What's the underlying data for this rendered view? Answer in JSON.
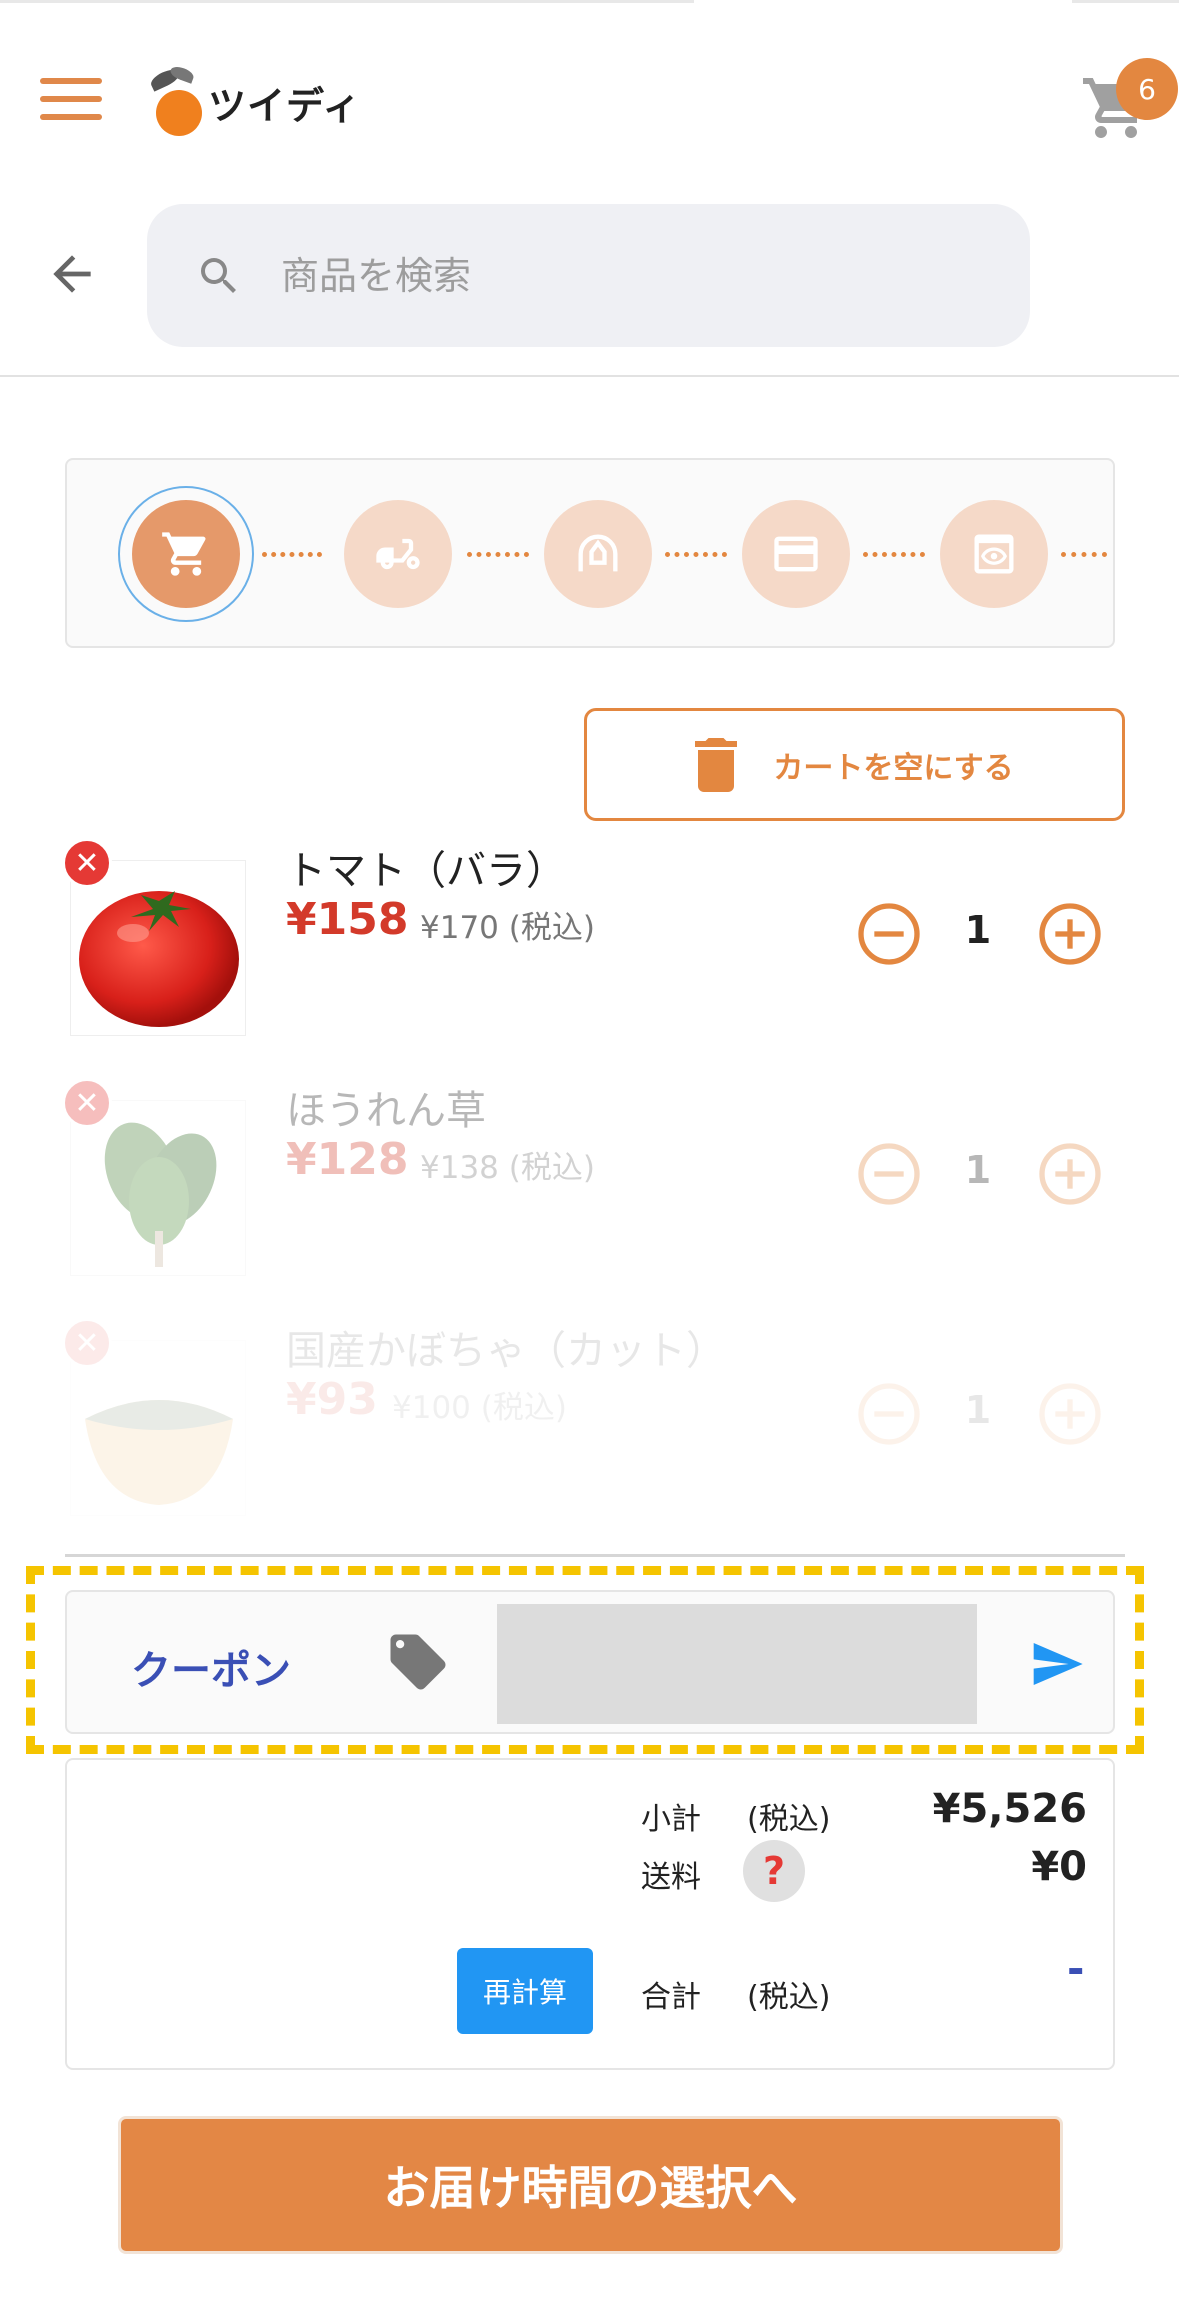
{
  "header": {
    "app_name": "ツイディ",
    "cart_count": "6"
  },
  "search": {
    "placeholder": "商品を検索"
  },
  "steps": [
    {
      "icon": "cart-icon",
      "active": true
    },
    {
      "icon": "delivery-scooter-icon",
      "active": false
    },
    {
      "icon": "address-icon",
      "active": false
    },
    {
      "icon": "credit-card-icon",
      "active": false
    },
    {
      "icon": "review-icon",
      "active": false
    }
  ],
  "clear_cart": {
    "label": "カートを空にする"
  },
  "items": [
    {
      "name": "トマト（バラ）",
      "price": "¥158",
      "original_price": "¥170 (税込)",
      "quantity": "1"
    },
    {
      "name": "ほうれん草",
      "price": "¥128",
      "original_price": "¥138 (税込)",
      "quantity": "1"
    },
    {
      "name": "国産かぼちゃ（カット）",
      "price": "¥93",
      "original_price": "¥100 (税込)",
      "quantity": "1"
    }
  ],
  "coupon": {
    "label": "クーポン",
    "value": ""
  },
  "totals": {
    "subtotal_label": "小計",
    "tax_included": "(税込)",
    "subtotal_value": "¥5,526",
    "shipping_label": "送料",
    "help_mark": "?",
    "shipping_value": "¥0",
    "recalc_label": "再計算",
    "total_label": "合計",
    "total_tax_included": "(税込)",
    "total_value": "-"
  },
  "cta": {
    "label": "お届け時間の選択へ"
  },
  "colors": {
    "accent": "#e38740",
    "price_red": "#d33a2a",
    "link_blue": "#3a4fb5",
    "button_blue": "#2196f3",
    "highlight_yellow": "#f5c400"
  }
}
